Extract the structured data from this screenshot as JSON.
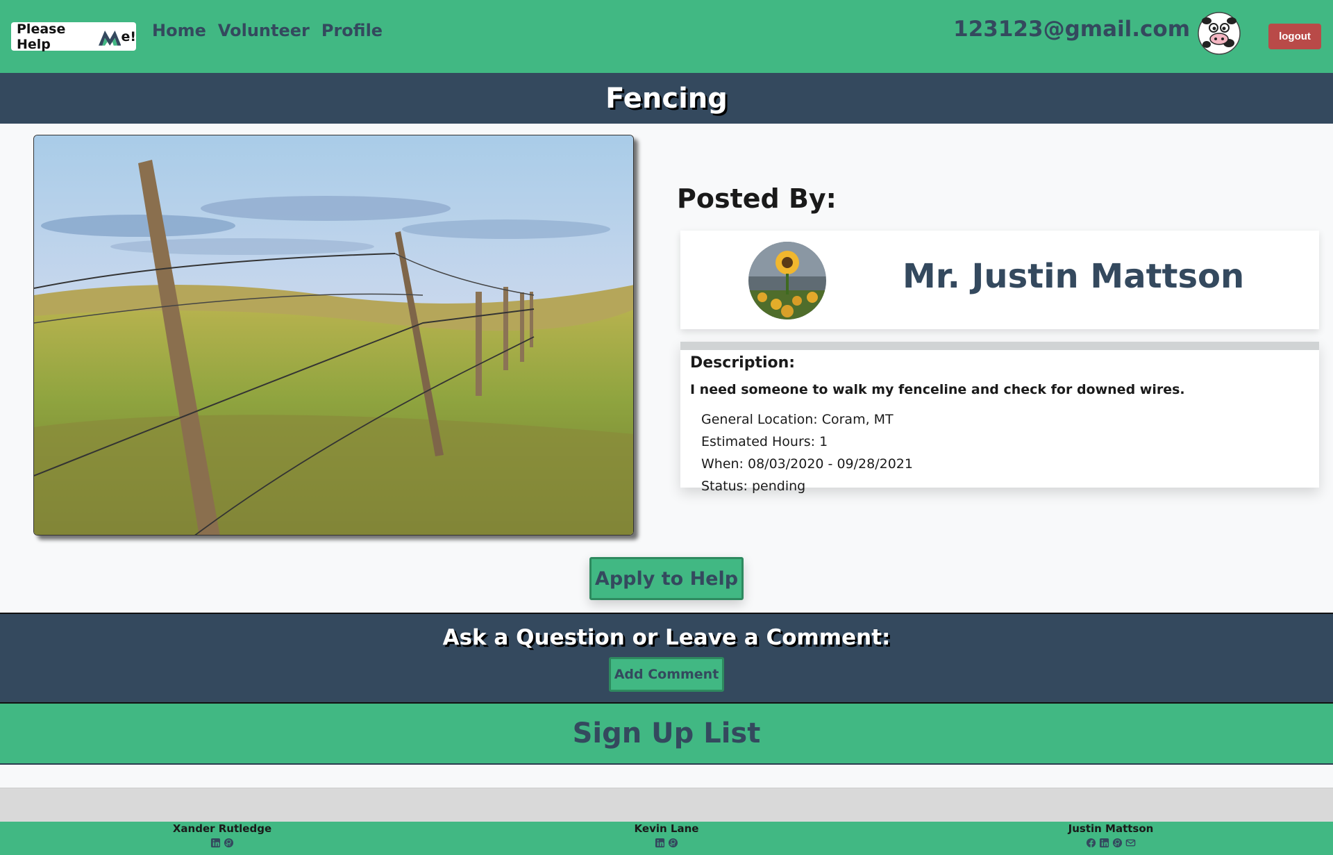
{
  "navbar": {
    "brand_text": "Please Help",
    "brand_suffix": "e!",
    "links": [
      "Home",
      "Volunteer",
      "Profile"
    ],
    "user_email": "123123@gmail.com",
    "logout_label": "logout"
  },
  "task": {
    "title": "Fencing",
    "posted_by_label": "Posted By:",
    "poster_name": "Mr. Justin Mattson",
    "description_label": "Description:",
    "description": "I need someone to walk my fenceline and check for downed wires.",
    "location": "General Location: Coram, MT",
    "hours": "Estimated Hours: 1",
    "when": "When: 08/03/2020 - 09/28/2021",
    "status": "Status: pending",
    "apply_label": "Apply to Help"
  },
  "comments": {
    "heading": "Ask a Question or Leave a Comment:",
    "add_label": "Add Comment"
  },
  "signup": {
    "heading": "Sign Up List"
  },
  "footer": {
    "authors": [
      {
        "name": "Xander Rutledge",
        "icons": [
          "linkedin-icon",
          "github-icon"
        ]
      },
      {
        "name": "Kevin Lane",
        "icons": [
          "linkedin-icon",
          "github-icon"
        ]
      },
      {
        "name": "Justin Mattson",
        "icons": [
          "facebook-icon",
          "linkedin-icon",
          "github-icon",
          "email-icon"
        ]
      }
    ]
  },
  "colors": {
    "primary_green": "#41b883",
    "dark_slate": "#34495e",
    "logout_red": "#b94a48",
    "page_bg": "#f8f9fa"
  }
}
